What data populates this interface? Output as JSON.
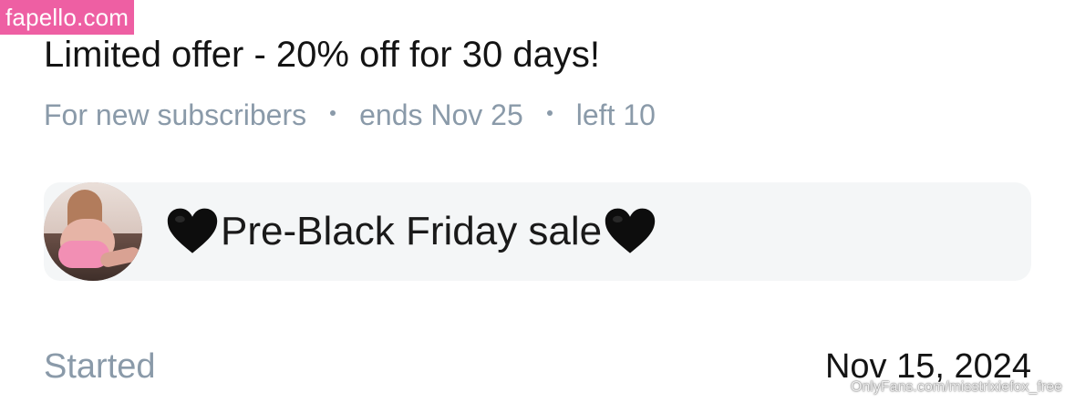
{
  "watermark": {
    "site": "fapello.com",
    "footer": "OnlyFans.com/misstrixiefox_free"
  },
  "offer": {
    "title": "Limited offer - 20% off for 30 days!",
    "audience": "For new subscribers",
    "ends": "ends Nov 25",
    "remaining": "left 10"
  },
  "message": {
    "text": "Pre-Black Friday sale",
    "emoji": "black-heart-icon"
  },
  "details": {
    "started_label": "Started",
    "started_date": "Nov 15, 2024"
  },
  "colors": {
    "accent_watermark": "#ee5fa3",
    "muted_text": "#8a9aa9",
    "card_background": "#f4f6f7"
  }
}
